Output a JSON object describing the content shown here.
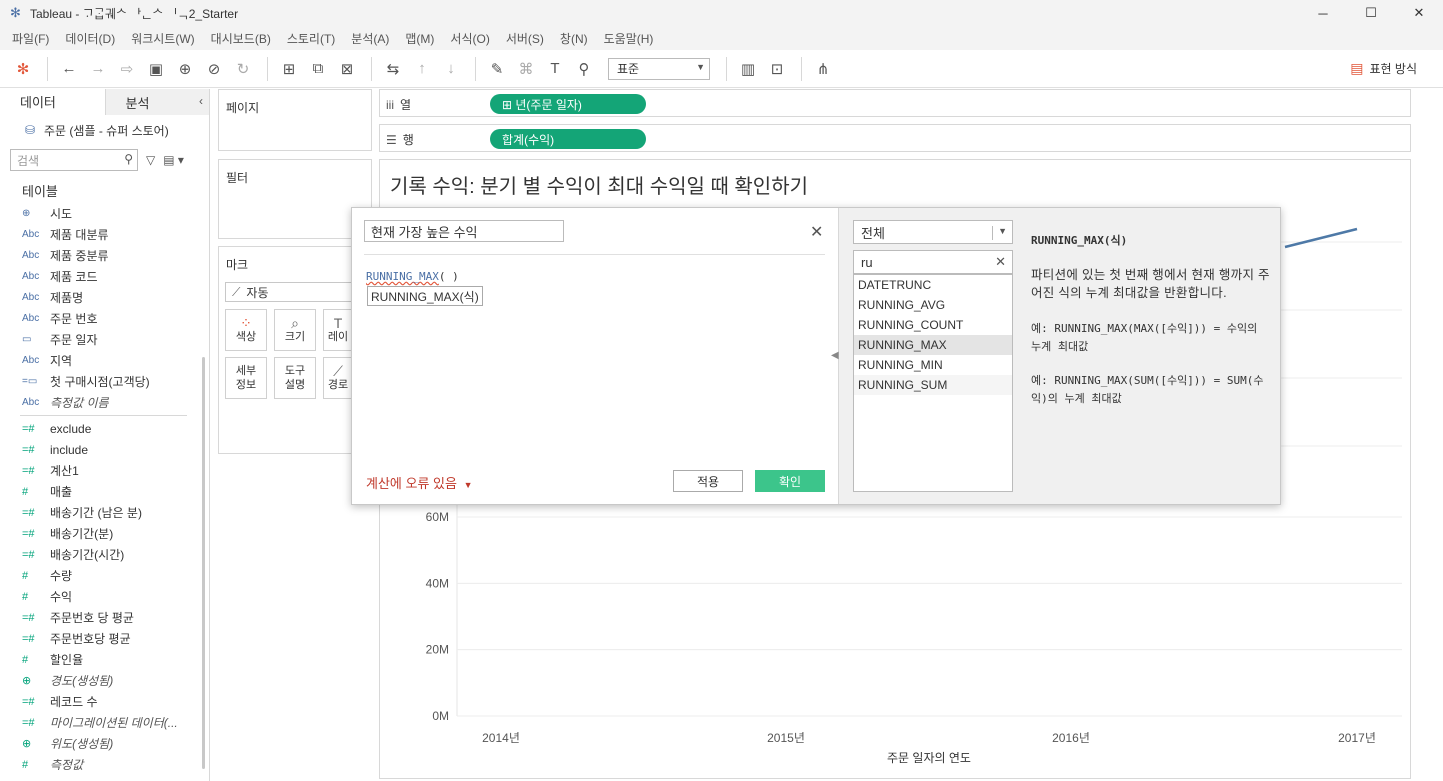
{
  "window": {
    "title": "Tableau - ᄀᆞᄀᆞᆸᄀᆌᄉ ᅡᆫᄉ ᅵᆨ2_Starter",
    "minimize": "─",
    "maximize": "☐",
    "close": "✕"
  },
  "menu": [
    "파일(F)",
    "데이터(D)",
    "워크시트(W)",
    "대시보드(B)",
    "스토리(T)",
    "분석(A)",
    "맵(M)",
    "서식(O)",
    "서버(S)",
    "창(N)",
    "도움말(H)"
  ],
  "toolbar": {
    "view_size": "표준",
    "show_me": "표현 방식"
  },
  "data_pane": {
    "tab_data": "데이터",
    "tab_analytics": "분석",
    "datasource": "주문 (샘플 - 슈퍼 스토어)",
    "search_placeholder": "검색",
    "section_tables": "테이블",
    "dimensions": [
      {
        "icon": "globe",
        "label": "시도"
      },
      {
        "icon": "abc",
        "label": "제품 대분류"
      },
      {
        "icon": "abc",
        "label": "제품 중분류"
      },
      {
        "icon": "abc",
        "label": "제품 코드"
      },
      {
        "icon": "abc",
        "label": "제품명"
      },
      {
        "icon": "abc",
        "label": "주문 번호"
      },
      {
        "icon": "date",
        "label": "주문 일자"
      },
      {
        "icon": "abc",
        "label": "지역"
      },
      {
        "icon": "calc-date",
        "label": "첫 구매시점(고객당)"
      },
      {
        "icon": "abc",
        "label": "측정값 이름"
      }
    ],
    "measures": [
      {
        "icon": "calc",
        "label": "exclude"
      },
      {
        "icon": "calc",
        "label": "include"
      },
      {
        "icon": "calc",
        "label": "계산1"
      },
      {
        "icon": "num",
        "label": "매출"
      },
      {
        "icon": "calc",
        "label": "배송기간 (남은 분)"
      },
      {
        "icon": "calc",
        "label": "배송기간(분)"
      },
      {
        "icon": "calc",
        "label": "배송기간(시간)"
      },
      {
        "icon": "num",
        "label": "수량"
      },
      {
        "icon": "num",
        "label": "수익"
      },
      {
        "icon": "calc",
        "label": "주문번호 당 평균"
      },
      {
        "icon": "calc",
        "label": "주문번호당 평균"
      },
      {
        "icon": "num",
        "label": "할인율"
      },
      {
        "icon": "globe",
        "label": "경도(생성됨)"
      },
      {
        "icon": "calc",
        "label": "레코드 수"
      },
      {
        "icon": "calc",
        "label": "마이그레이션된 데이터(..."
      },
      {
        "icon": "globe",
        "label": "위도(생성됨)"
      },
      {
        "icon": "num",
        "label": "측정값"
      }
    ]
  },
  "shelves": {
    "pages": "페이지",
    "filters": "필터",
    "marks": "마크",
    "mark_type": "자동",
    "color": "색상",
    "size": "크기",
    "label": "레이",
    "detail": "세부\n정보",
    "tooltip": "도구\n설명",
    "path": "경로",
    "columns_label": "열",
    "rows_label": "행",
    "columns_pill": "⊞ 년(주문 일자)",
    "rows_pill": "합계(수익)"
  },
  "view": {
    "title": "기록 수익: 분기 별 수익이 최대 수익일 때 확인하기"
  },
  "chart_data": {
    "type": "line",
    "xlabel": "주문 일자의 연도",
    "ylabel": "",
    "x": [
      "2014년",
      "2015년",
      "2016년",
      "2017년"
    ],
    "y_ticks": [
      "0M",
      "20M",
      "40M",
      "60M"
    ],
    "ylim": [
      0,
      60
    ],
    "series": [
      {
        "values": [
          null,
          null,
          null,
          null
        ]
      }
    ],
    "visible_segment_note": ""
  },
  "calc_dialog": {
    "name": "현재 가장 높은 수익",
    "formula_fn": "RUNNING_MAX",
    "formula_rest": "( )",
    "tooltip": "RUNNING_MAX(식)",
    "error": "계산에 오류 있음",
    "apply": "적용",
    "ok": "확인",
    "category": "전체",
    "search": "ru",
    "functions": [
      "DATETRUNC",
      "RUNNING_AVG",
      "RUNNING_COUNT",
      "RUNNING_MAX",
      "RUNNING_MIN",
      "RUNNING_SUM"
    ],
    "selected_function": "RUNNING_MAX",
    "desc_signature": "RUNNING_MAX(식)",
    "desc_body": "파티션에 있는 첫 번째 행에서 현재 행까지 주어진 식의 누계 최대값을 반환합니다.",
    "desc_ex1": "예: RUNNING_MAX(MAX([수익])) = 수익의 누계 최대값",
    "desc_ex2": "예: RUNNING_MAX(SUM([수익])) = SUM(수익)의 누계 최대값"
  },
  "colors": {
    "pill_green": "#14a577",
    "ok_green": "#3cc58b",
    "line_blue": "#4e79a7",
    "error_red": "#c0392b"
  }
}
